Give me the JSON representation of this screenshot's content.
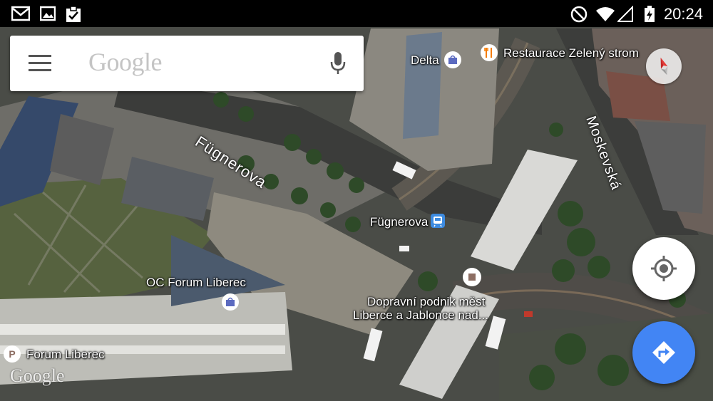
{
  "status_bar": {
    "time": "20:24",
    "left_icons": [
      "gmail-icon",
      "gallery-icon",
      "clipboard-check-icon"
    ],
    "right_icons": [
      "do-not-disturb-icon",
      "wifi-icon",
      "signal-icon",
      "battery-charging-icon"
    ]
  },
  "search": {
    "placeholder": "Google",
    "menu_icon": "hamburger-menu-icon",
    "voice_icon": "microphone-icon"
  },
  "map": {
    "type": "satellite",
    "streets": [
      "Fügnerova",
      "Moskevská"
    ],
    "places": {
      "delta": "Delta",
      "restaurace": "Restaurace Zelený strom",
      "fugnerova_stop": "Fügnerova",
      "dp_line1": "Dopravní podnik měst",
      "dp_line2": "Liberce a Jablonce nad...",
      "oc_forum": "OC Forum Liberec",
      "forum": "Forum Liberec"
    },
    "watermark": "Google"
  },
  "controls": {
    "compass_icon": "compass-icon",
    "my_location_icon": "my-location-icon",
    "directions_icon": "directions-icon",
    "directions_color": "#4285f4"
  }
}
